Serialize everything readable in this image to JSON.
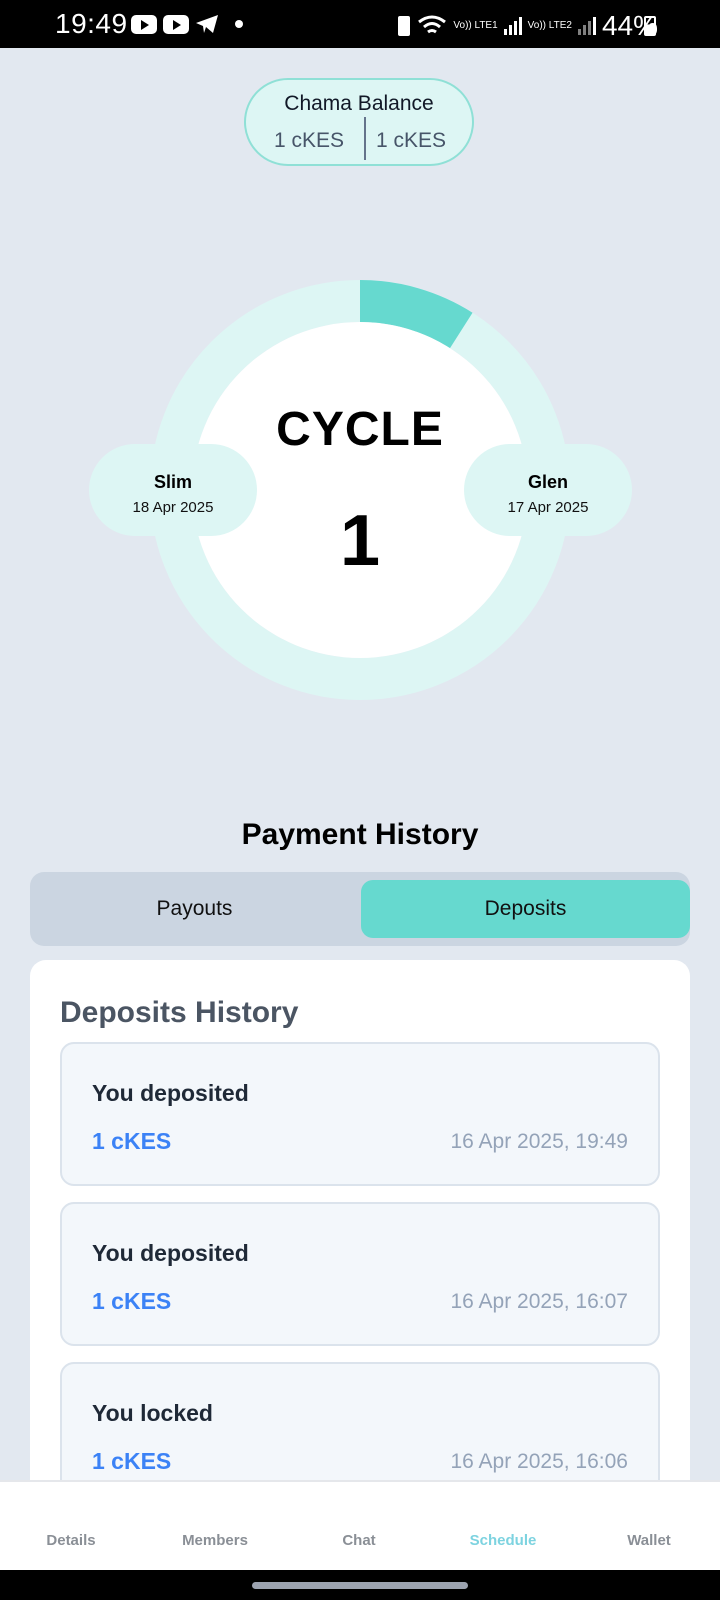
{
  "status_bar": {
    "time": "19:49",
    "network_1": "Vo)) LTE1",
    "network_2": "Vo)) LTE2",
    "battery": "44%"
  },
  "balance": {
    "title": "Chama Balance",
    "left_value": "1 cKES",
    "right_value": "1 cKES"
  },
  "cycle": {
    "label": "CYCLE",
    "number": "1",
    "progress_fraction": 0.09,
    "ring_color": "#ddf6f4",
    "progress_color": "#66d9cf"
  },
  "members": [
    {
      "name": "Slim",
      "date": "18 Apr 2025"
    },
    {
      "name": "Glen",
      "date": "17 Apr 2025"
    }
  ],
  "payment_history": {
    "title": "Payment History",
    "tabs": [
      {
        "label": "Payouts",
        "active": false
      },
      {
        "label": "Deposits",
        "active": true
      }
    ],
    "section_title": "Deposits History",
    "transactions": [
      {
        "action": "You deposited",
        "amount": "1 cKES",
        "date": "16 Apr 2025, 19:49"
      },
      {
        "action": "You deposited",
        "amount": "1 cKES",
        "date": "16 Apr 2025, 16:07"
      },
      {
        "action": "You locked",
        "amount": "1 cKES",
        "date": "16 Apr 2025, 16:06"
      }
    ]
  },
  "bottom_nav": [
    {
      "label": "Details",
      "active": false
    },
    {
      "label": "Members",
      "active": false
    },
    {
      "label": "Chat",
      "active": false
    },
    {
      "label": "Schedule",
      "active": true
    },
    {
      "label": "Wallet",
      "active": false
    }
  ],
  "colors": {
    "accent": "#66d9cf",
    "link": "#3b82f6",
    "active_nav": "#7dd3e0"
  }
}
